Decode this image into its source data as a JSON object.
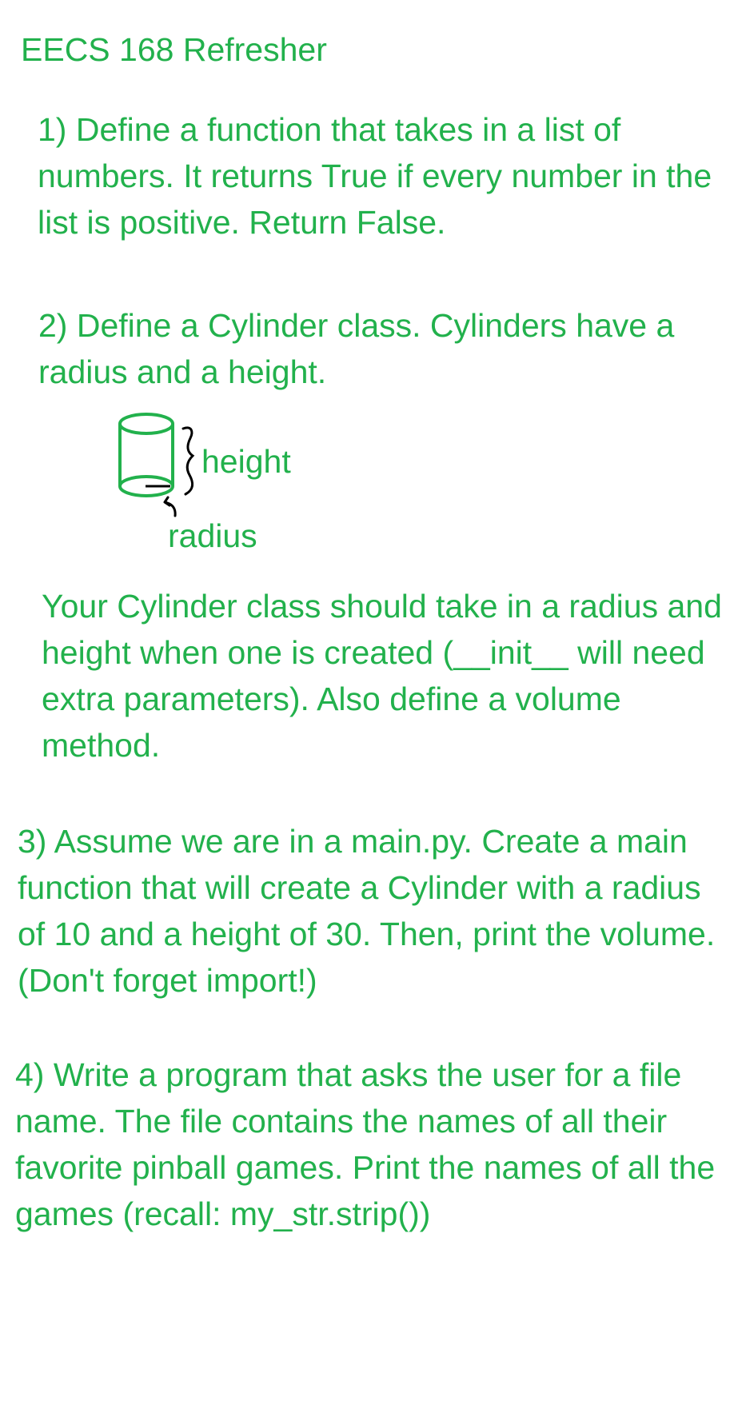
{
  "title": "EECS 168 Refresher",
  "questions": {
    "q1": "1) Define a function that takes in a list of numbers. It returns True if every number in the list is positive. Return False.",
    "q2": "2) Define a Cylinder class. Cylinders have a radius and a height.",
    "q2_detail": "Your Cylinder class should take in a radius and height when one is created (__init__ will need extra parameters). Also define a volume method.",
    "q3": "3) Assume we are in a main.py. Create a main function that will create a Cylinder with a radius of 10 and a height of 30. Then, print the volume. (Don't forget import!)",
    "q4": "4) Write a program that asks the user for a file name. The file contains the names of all their favorite pinball games. Print the names of all the games (recall: my_str.strip())"
  },
  "diagram": {
    "height_label": "height",
    "radius_label": "radius",
    "cylinder_color": "#22b14c",
    "annotation_color": "#000000"
  },
  "colors": {
    "text": "#22b14c",
    "background": "#ffffff"
  }
}
